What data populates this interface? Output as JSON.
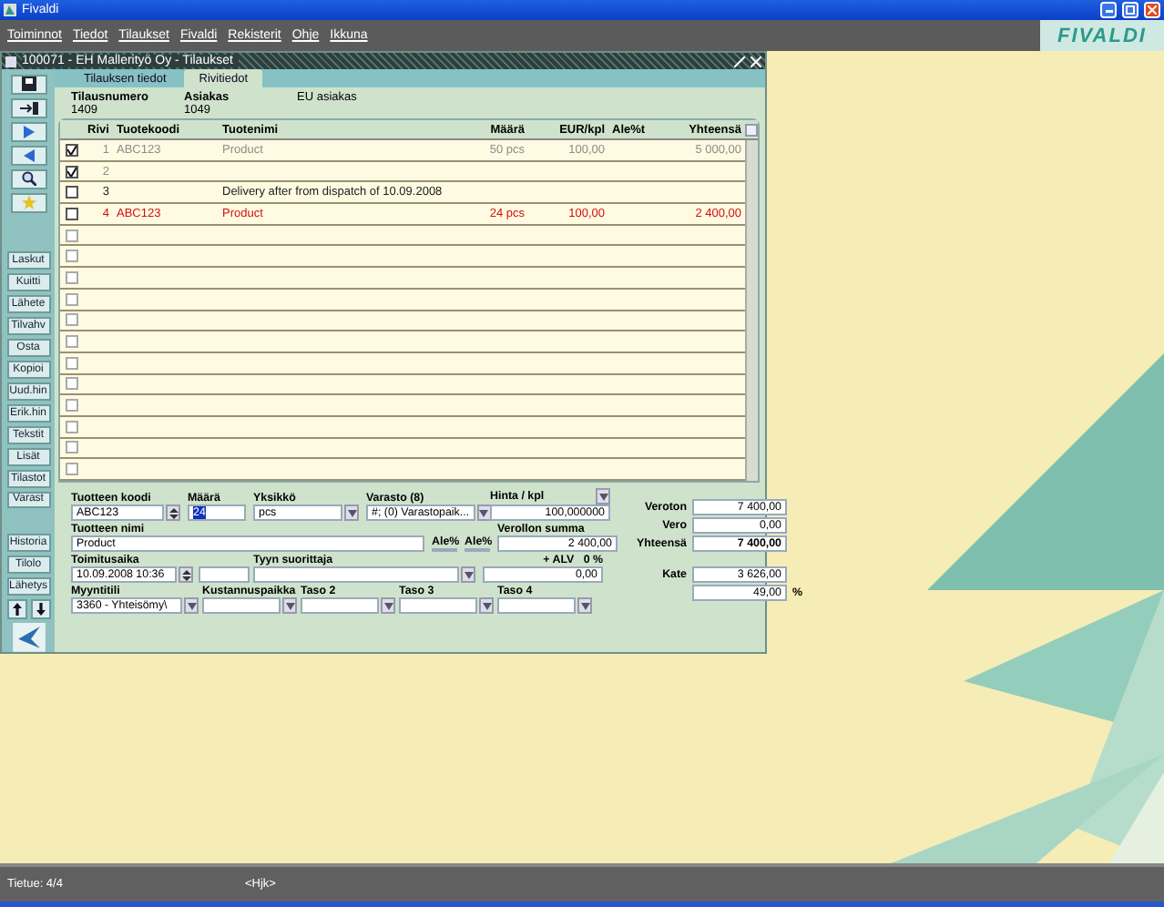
{
  "app_title": "Fivaldi",
  "menu": [
    "Toiminnot",
    "Tiedot",
    "Tilaukset",
    "Fivaldi",
    "Rekisterit",
    "Ohje",
    "Ikkuna"
  ],
  "logo": "FIVALDI",
  "window": {
    "title": "100071 - EH Mallerityö Oy - Tilaukset",
    "tabs": [
      {
        "label": "Tilauksen tiedot",
        "selected": false
      },
      {
        "label": "Rivitiedot",
        "selected": true
      }
    ]
  },
  "toolbar": {
    "icons": [
      {
        "kind": "save"
      },
      {
        "kind": "exit"
      },
      {
        "kind": "next"
      },
      {
        "kind": "prev"
      },
      {
        "kind": "search"
      },
      {
        "kind": "new"
      }
    ],
    "buttons": [
      "Laskut",
      "Kuitti",
      "Lähete",
      "Tilvahv",
      "Osta",
      "Kopioi",
      "Uud.hin",
      "Erik.hin",
      "Tekstit",
      "Lisät",
      "Tilastot",
      "Varast"
    ],
    "lower_buttons": [
      "Historia",
      "Tilolo",
      "Lähetys"
    ]
  },
  "header": {
    "fields": [
      {
        "label": "Tilausnumero",
        "value": "1409"
      },
      {
        "label": "Asiakas",
        "value": "1049"
      }
    ],
    "note": "EU asiakas"
  },
  "table": {
    "columns": [
      "Rivi",
      "Tuotekoodi",
      "Tuotenimi",
      "Määrä",
      "EUR/kpl",
      "Ale%t",
      "Yhteensä"
    ],
    "rows": [
      {
        "checked": true,
        "disabled": false,
        "color": "#8c8c8c",
        "number": "1",
        "code": "ABC123",
        "name": "Product",
        "qty": "50 pcs",
        "price": "100,00",
        "total": "5 000,00"
      },
      {
        "checked": true,
        "disabled": false,
        "color": "#8c8c8c",
        "number": "2"
      },
      {
        "checked": false,
        "disabled": false,
        "color": "#202020",
        "number": "3",
        "name": "Delivery after from dispatch of 10.09.2008"
      },
      {
        "checked": false,
        "disabled": false,
        "color": "#d01010",
        "number": "4",
        "code": "ABC123",
        "name": "Product",
        "qty": "24 pcs",
        "price": "100,00",
        "total": "2 400,00"
      },
      {
        "checked": false,
        "disabled": true
      },
      {
        "checked": false,
        "disabled": true
      },
      {
        "checked": false,
        "disabled": true
      },
      {
        "checked": false,
        "disabled": true
      },
      {
        "checked": false,
        "disabled": true
      },
      {
        "checked": false,
        "disabled": true
      },
      {
        "checked": false,
        "disabled": true
      },
      {
        "checked": false,
        "disabled": true
      },
      {
        "checked": false,
        "disabled": true
      },
      {
        "checked": false,
        "disabled": true
      },
      {
        "checked": false,
        "disabled": true
      },
      {
        "checked": false,
        "disabled": true
      }
    ]
  },
  "form": {
    "product_code": {
      "label": "Tuotteen koodi",
      "value": "ABC123"
    },
    "quantity": {
      "label": "Määrä",
      "value": "24"
    },
    "unit": {
      "label": "Yksikkö",
      "value": "pcs"
    },
    "warehouse": {
      "label": "Varasto (8)",
      "value": "#; (0) Varastopaik..."
    },
    "price": {
      "label": "Hinta / kpl",
      "value": "100,000000"
    },
    "product_name": {
      "label": "Tuotteen nimi",
      "value": "Product"
    },
    "discounts": [
      "Ale%",
      "Ale%"
    ],
    "net_sum": {
      "label": "Verollon summa",
      "value": "2 400,00"
    },
    "delivery_time": {
      "label": "Toimitusaika",
      "value": "10.09.2008 10:36"
    },
    "performer": {
      "label": "Tyyn suorittaja"
    },
    "vat": {
      "label": "+ ALV   0 %",
      "value": "0,00"
    },
    "accounts": [
      {
        "label": "Myyntitili",
        "value": "3360 - Yhteisömy\\"
      },
      {
        "label": "Kustannuspaikka"
      },
      {
        "label": "Taso 2"
      },
      {
        "label": "Taso 3"
      },
      {
        "label": "Taso 4"
      }
    ]
  },
  "totals": [
    {
      "kind": "plain",
      "label": "Veroton",
      "value": "7 400,00"
    },
    {
      "kind": "plain",
      "label": "Vero",
      "value": "0,00"
    },
    {
      "kind": "total",
      "label": "Yhteensä",
      "value": "7 400,00"
    }
  ],
  "margin": {
    "label": "Kate",
    "value": "3 626,00",
    "percent": "49,00",
    "unit": "%"
  },
  "status_bar": {
    "record": "Tietue: 4/4",
    "mode": "<Hjk>"
  }
}
